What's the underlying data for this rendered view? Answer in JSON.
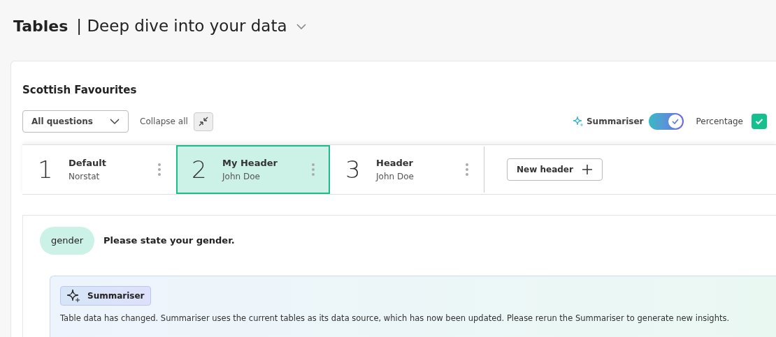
{
  "page": {
    "title": "Tables",
    "subtitle": "| Deep dive into your data"
  },
  "report": {
    "title": "Scottish Favourites"
  },
  "toolbar": {
    "filter": "All questions",
    "collapse_label": "Collapse all",
    "summariser_label": "Summariser",
    "summariser_on": true,
    "percentage_label": "Percentage",
    "percentage_checked": true
  },
  "headers": [
    {
      "number": "1",
      "name": "Default",
      "owner": "Norstat",
      "selected": false
    },
    {
      "number": "2",
      "name": "My Header",
      "owner": "John Doe",
      "selected": true
    },
    {
      "number": "3",
      "name": "Header",
      "owner": "John Doe",
      "selected": false
    }
  ],
  "new_header_button": "New header",
  "question": {
    "tag": "gender",
    "text": "Please state your gender."
  },
  "summariser_notice": {
    "badge": "Summariser",
    "message": "Table data has changed. Summariser uses the current tables as its data source, which has now been updated. Please rerun the Summariser to generate new insights."
  }
}
